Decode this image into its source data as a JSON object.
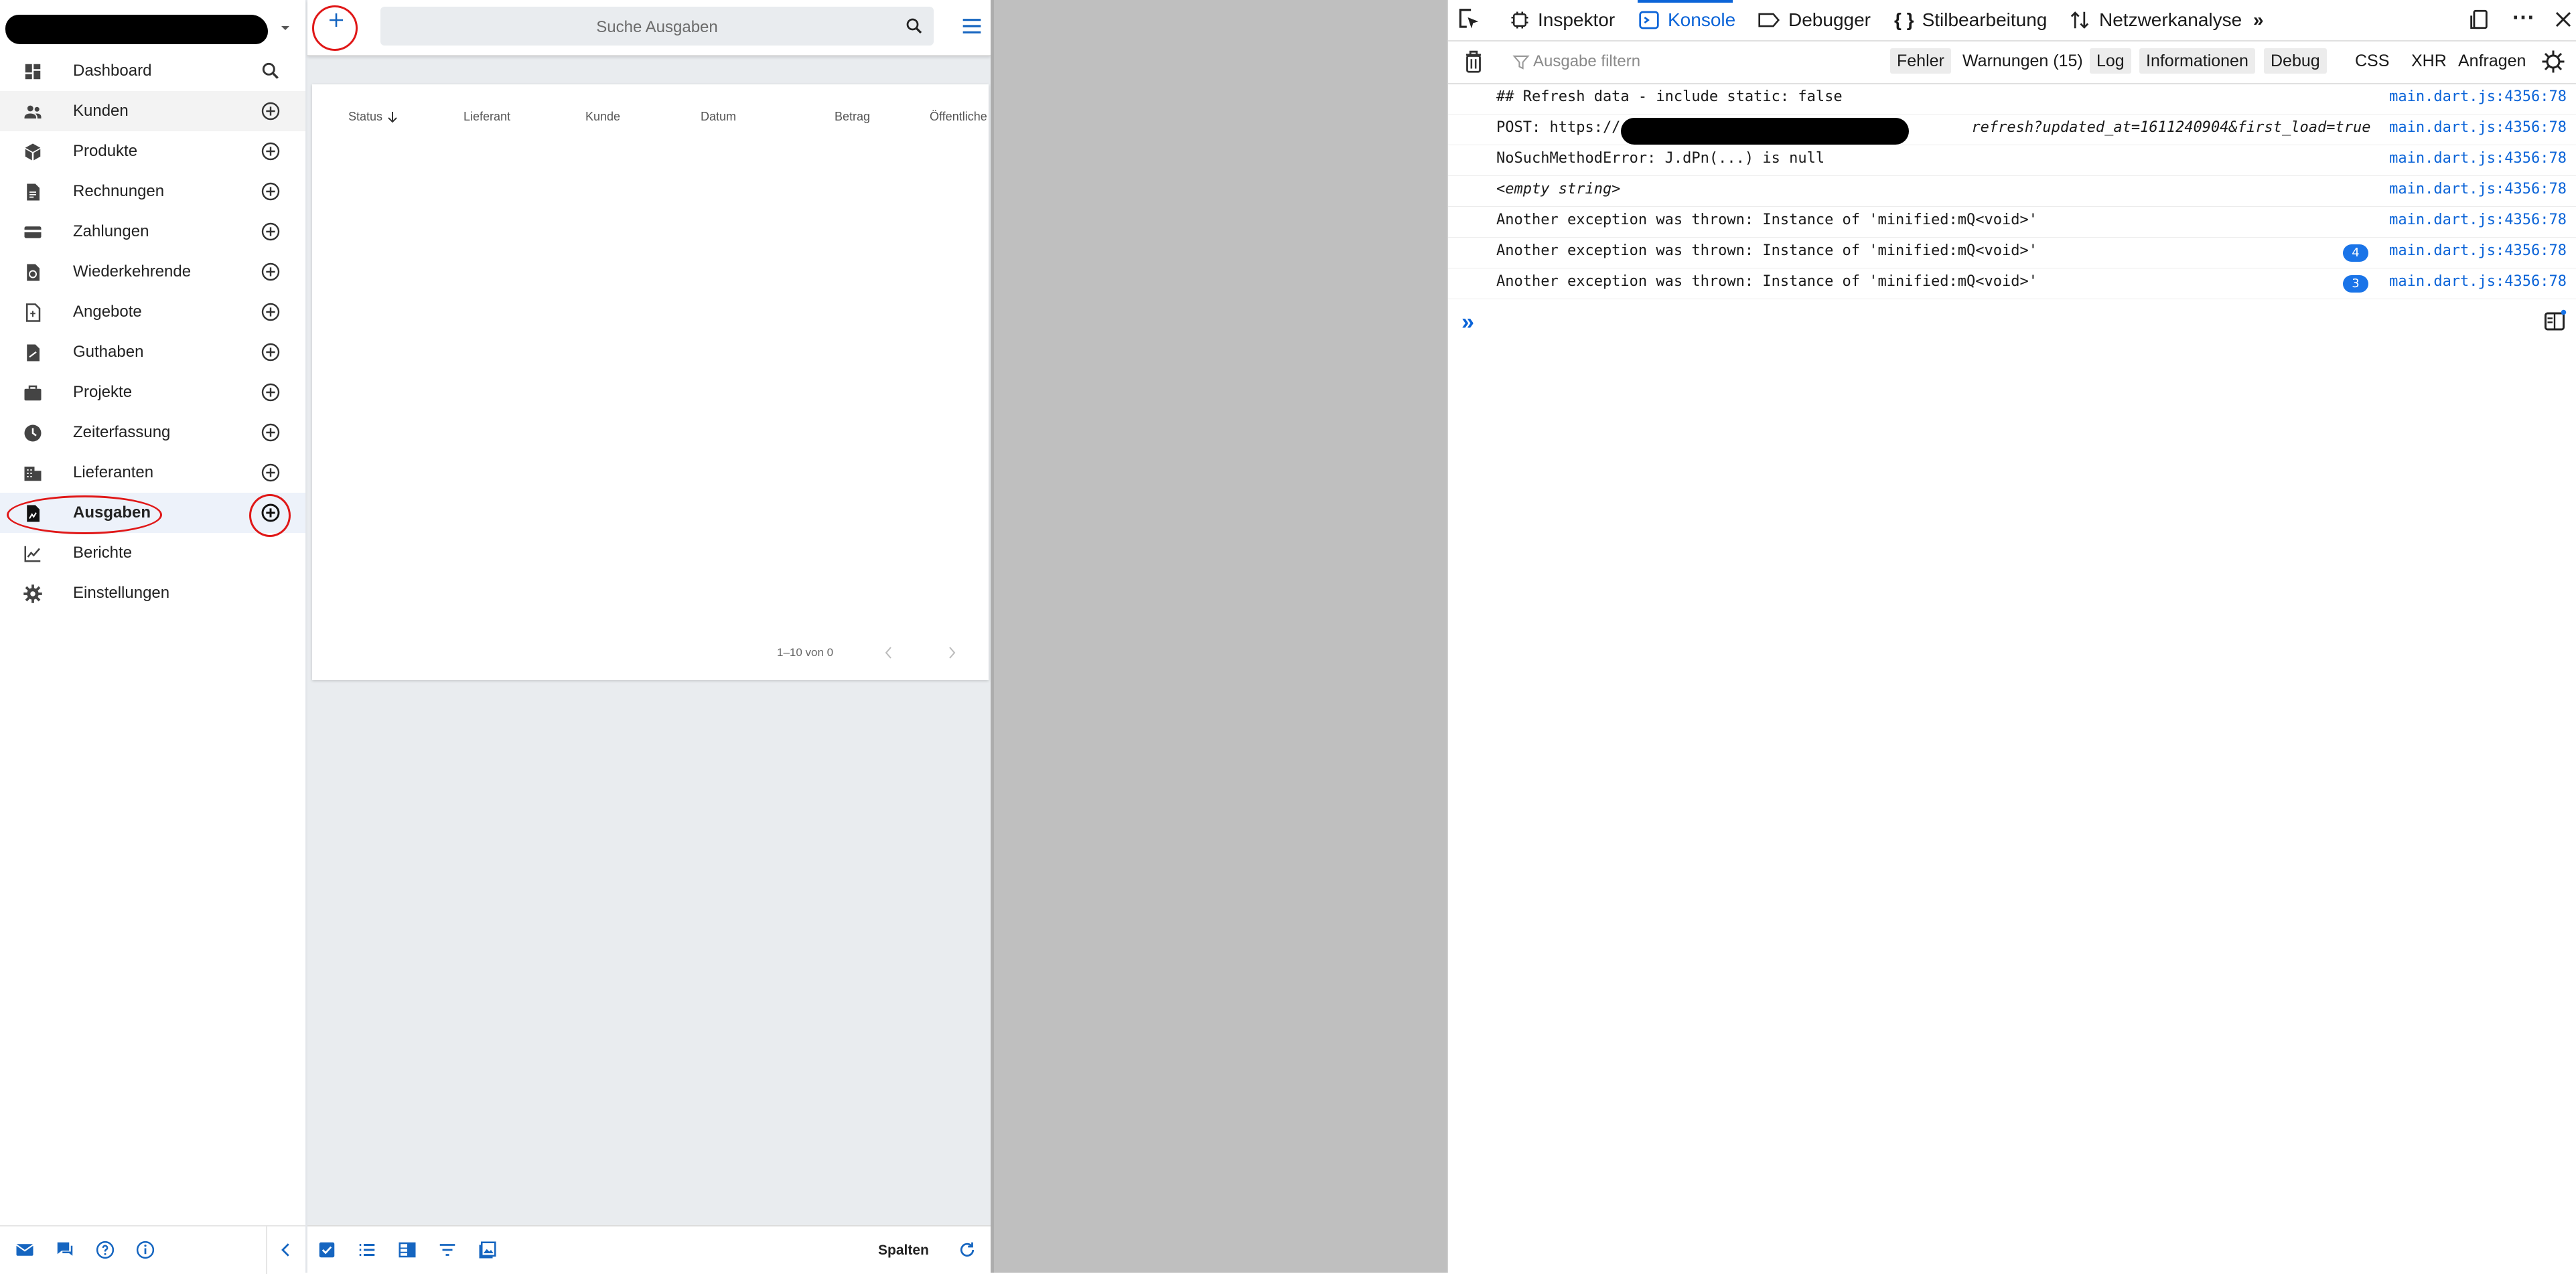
{
  "sidebar": {
    "company_name": "",
    "items": [
      {
        "label": "Dashboard",
        "icon": "dashboard-icon",
        "action": "search-icon"
      },
      {
        "label": "Kunden",
        "icon": "people-icon",
        "action": "add-circle-icon"
      },
      {
        "label": "Produkte",
        "icon": "cube-icon",
        "action": "add-circle-icon"
      },
      {
        "label": "Rechnungen",
        "icon": "invoice-icon",
        "action": "add-circle-icon"
      },
      {
        "label": "Zahlungen",
        "icon": "credit-card-icon",
        "action": "add-circle-icon"
      },
      {
        "label": "Wiederkehrende",
        "icon": "recurring-icon",
        "action": "add-circle-icon"
      },
      {
        "label": "Angebote",
        "icon": "quote-icon",
        "action": "add-circle-icon"
      },
      {
        "label": "Guthaben",
        "icon": "credit-icon",
        "action": "add-circle-icon"
      },
      {
        "label": "Projekte",
        "icon": "briefcase-icon",
        "action": "add-circle-icon"
      },
      {
        "label": "Zeiterfassung",
        "icon": "clock-icon",
        "action": "add-circle-icon"
      },
      {
        "label": "Lieferanten",
        "icon": "building-icon",
        "action": "add-circle-icon"
      },
      {
        "label": "Ausgaben",
        "icon": "expense-icon",
        "action": "add-circle-icon"
      },
      {
        "label": "Berichte",
        "icon": "chart-line-icon",
        "action": ""
      },
      {
        "label": "Einstellungen",
        "icon": "gear-icon",
        "action": ""
      }
    ],
    "selected": "Ausgaben",
    "footer_icons": [
      "mail-icon",
      "chat-icon",
      "help-icon",
      "info-icon",
      "collapse-chevron-icon"
    ]
  },
  "main": {
    "search_placeholder": "Suche Ausgaben",
    "columns": [
      "Status",
      "Lieferant",
      "Kunde",
      "Datum",
      "Betrag",
      "Öffentliche"
    ],
    "sort_column": "Status",
    "pagination": "1–10 von 0",
    "bottom_bar_icons": [
      "checkbox-icon",
      "list-icon",
      "table-icon",
      "filter-icon",
      "image-icon"
    ],
    "columns_button": "Spalten"
  },
  "devtools": {
    "tabs": [
      "Inspektor",
      "Konsole",
      "Debugger",
      "Stilbearbeitung",
      "Netzwerkanalyse"
    ],
    "active_tab": "Konsole",
    "filter_placeholder": "Ausgabe filtern",
    "filter_buttons": [
      "Fehler",
      "Warnungen (15)",
      "Log",
      "Informationen",
      "Debug",
      "CSS",
      "XHR",
      "Anfragen"
    ],
    "messages": [
      {
        "text": "## Refresh data - include static: false",
        "source": "main.dart.js:4356:78",
        "count": ""
      },
      {
        "text_prefix": "POST: https://",
        "text_suffix": "refresh?updated_at=1611240904&first_load=true",
        "source": "main.dart.js:4356:78",
        "count": ""
      },
      {
        "text": "NoSuchMethodError: J.dPn(...) is null",
        "source": "main.dart.js:4356:78",
        "count": ""
      },
      {
        "text": "<empty string>",
        "source": "main.dart.js:4356:78",
        "count": ""
      },
      {
        "text": "Another exception was thrown: Instance of 'minified:mQ<void>'",
        "source": "main.dart.js:4356:78",
        "count": ""
      },
      {
        "text": "Another exception was thrown: Instance of 'minified:mQ<void>'",
        "source": "main.dart.js:4356:78",
        "count": "4"
      },
      {
        "text": "Another exception was thrown: Instance of 'minified:mQ<void>'",
        "source": "main.dart.js:4356:78",
        "count": "3"
      }
    ]
  },
  "colors": {
    "accent": "#1a74e8",
    "annotation": "#e01818",
    "selected_bg": "#edf2fa"
  }
}
